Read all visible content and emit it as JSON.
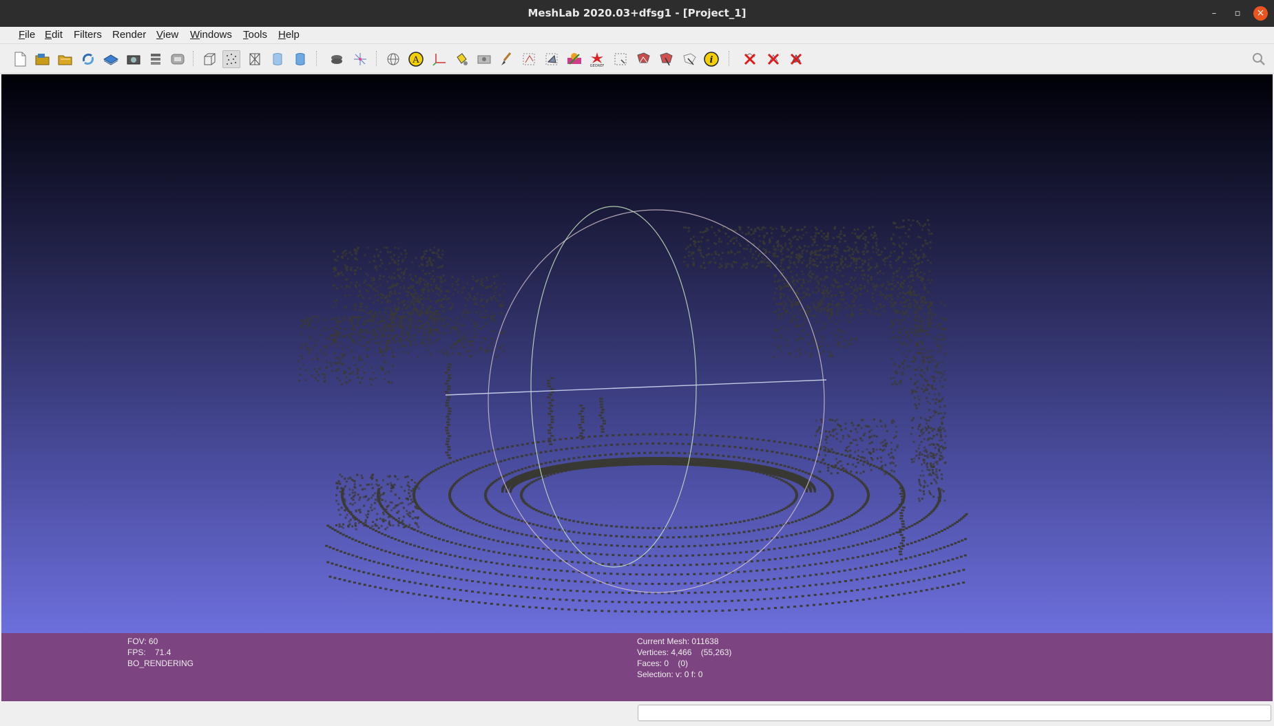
{
  "window": {
    "title": "MeshLab 2020.03+dfsg1 - [Project_1]",
    "minimize_glyph": "–",
    "restore_glyph": "▫",
    "close_glyph": "×"
  },
  "menu": [
    {
      "first": "F",
      "rest": "ile"
    },
    {
      "first": "E",
      "rest": "dit"
    },
    {
      "first": "",
      "rest": "Filters"
    },
    {
      "first": "",
      "rest": "Render"
    },
    {
      "first": "V",
      "rest": "iew"
    },
    {
      "first": "W",
      "rest": "indows"
    },
    {
      "first": "T",
      "rest": "ools"
    },
    {
      "first": "H",
      "rest": "elp"
    }
  ],
  "toolbar_icons": [
    "new-project-icon",
    "open-project-icon",
    "import-mesh-icon",
    "reload-icon",
    "export-mesh-icon",
    "snapshot-icon",
    "layers-icon",
    "raster-icon",
    "bounding-box-icon",
    "points-icon",
    "wireframe-icon",
    "flat-icon",
    "smooth-icon",
    "lighting-icon",
    "axes-trackball-icon",
    "sphere-icon",
    "annotation-a-icon",
    "axis-icon",
    "paint-bucket-icon",
    "camera-align-icon",
    "brush-icon",
    "select-vertices-icon",
    "select-faces-icon",
    "measure-icon",
    "georef-icon",
    "select-region-icon",
    "select-icon",
    "pick-points-icon",
    "select-connected-icon",
    "info-icon",
    "delete-selected-icon",
    "delete-vertices-icon",
    "delete-faces-icon"
  ],
  "info": {
    "fov": "FOV: 60",
    "fps": "FPS:    71.4",
    "rendering": "BO_RENDERING",
    "current_mesh": "Current Mesh: 011638",
    "vertices": "Vertices: 4,466    (55,263)",
    "faces": "Faces: 0    (0)",
    "selection": "Selection: v: 0 f: 0"
  },
  "colors": {
    "info_panel": "#7c4480",
    "viewport_top": "#000007",
    "viewport_bottom": "#6d6fdc",
    "point_cloud": "#3a3a32",
    "trackball": "#cfcfcf"
  }
}
